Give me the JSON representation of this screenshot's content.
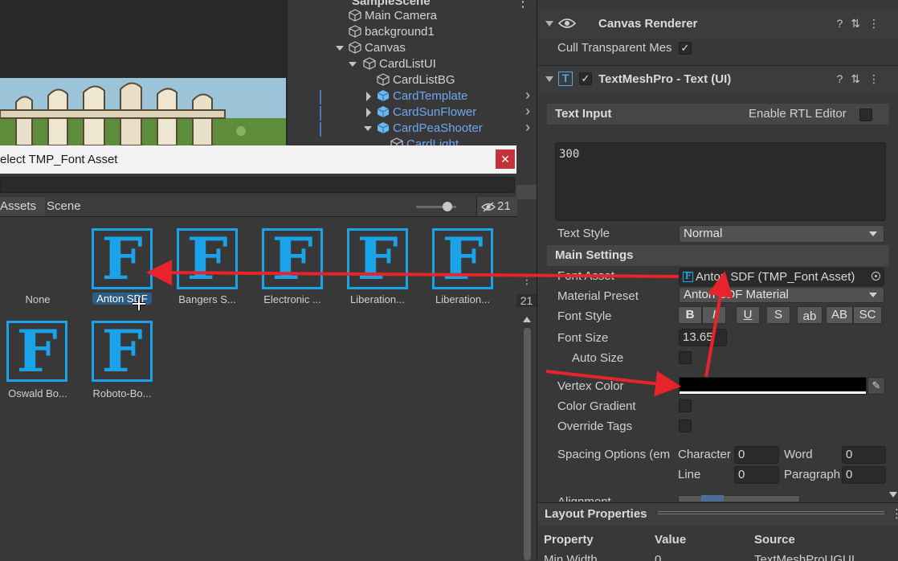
{
  "hierarchy": {
    "scene": "SampleScene",
    "items": [
      {
        "label": "Main Camera",
        "blue": false
      },
      {
        "label": "background1",
        "blue": false
      },
      {
        "label": "Canvas",
        "blue": false
      },
      {
        "label": "CardListUI",
        "blue": false
      },
      {
        "label": "CardListBG",
        "blue": false
      },
      {
        "label": "CardTemplate",
        "blue": true
      },
      {
        "label": "CardSunFlower",
        "blue": true
      },
      {
        "label": "CardPeaShooter",
        "blue": true
      },
      {
        "label": "CardLight",
        "blue": true
      }
    ]
  },
  "dialog": {
    "title": "elect TMP_Font Asset",
    "close": "✕",
    "tabs": {
      "assets": "Assets",
      "scene": "Scene"
    },
    "count": "21",
    "none_label": "None",
    "fonts": [
      {
        "label": "Anton SDF",
        "selected": true
      },
      {
        "label": "Bangers S...",
        "selected": false
      },
      {
        "label": "Electronic ...",
        "selected": false
      },
      {
        "label": "Liberation...",
        "selected": false
      },
      {
        "label": "Liberation...",
        "selected": false
      },
      {
        "label": "Oswald Bo...",
        "selected": false
      },
      {
        "label": "Roboto-Bo...",
        "selected": false
      }
    ],
    "icon_letter": "F"
  },
  "side_count": "21",
  "inspector": {
    "canvas_renderer": {
      "title": "Canvas Renderer",
      "cull_label": "Cull Transparent Mes",
      "cull_checked": "✓"
    },
    "tmp": {
      "title": "TextMeshPro - Text (UI)",
      "enabled_check": "✓",
      "text_input_header": "Text Input",
      "rtl_label": "Enable RTL Editor",
      "text_value": "300",
      "text_style_label": "Text Style",
      "text_style_value": "Normal",
      "main_settings_header": "Main Settings",
      "font_asset_label": "Font Asset",
      "font_asset_value": "Anton SDF (TMP_Font Asset)",
      "material_label": "Material Preset",
      "material_value": "Anton SDF Material",
      "font_style_label": "Font Style",
      "font_style_buttons": [
        "B",
        "I",
        "U",
        "S",
        "ab",
        "AB",
        "SC"
      ],
      "font_size_label": "Font Size",
      "font_size_value": "13.65",
      "auto_size_label": "Auto Size",
      "vertex_color_label": "Vertex Color",
      "vertex_color": "#000000",
      "color_gradient_label": "Color Gradient",
      "override_tags_label": "Override Tags",
      "spacing_label": "Spacing Options (em",
      "character_label": "Character",
      "character_value": "0",
      "word_label": "Word",
      "word_value": "0",
      "line_label": "Line",
      "line_value": "0",
      "paragraph_label": "Paragraph",
      "paragraph_value": "0",
      "alignment_label": "Alignment"
    },
    "layout": {
      "header": "Layout Properties",
      "col_property": "Property",
      "col_value": "Value",
      "col_source": "Source",
      "row_property": "Min Width",
      "row_value": "0",
      "row_source": "TextMeshProUGUI"
    }
  },
  "colors": {
    "accent_blue": "#1aa3e8",
    "annotation_red": "#e8232c",
    "selection": "#2c5d87"
  }
}
